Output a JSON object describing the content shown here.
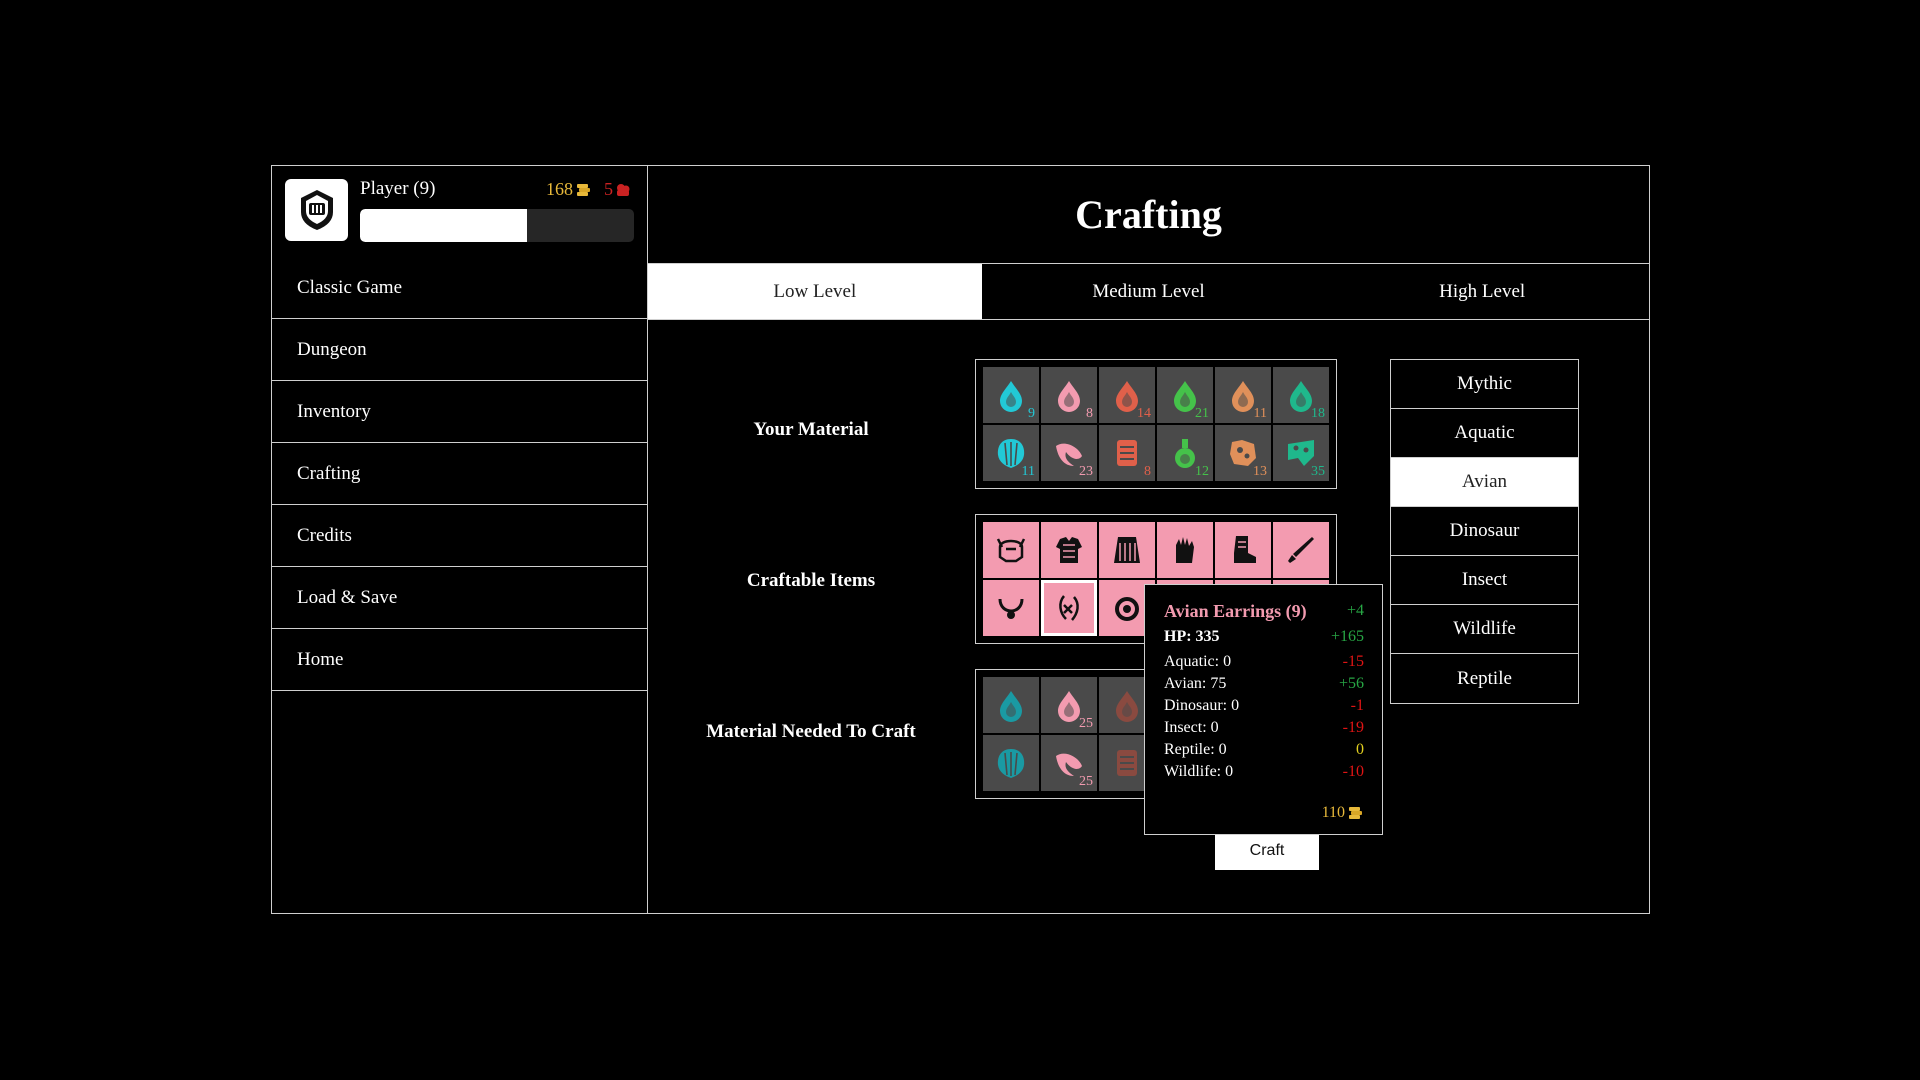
{
  "player": {
    "name": "Player (9)",
    "gold": "168",
    "gems": "5",
    "xp_fraction": 0.61
  },
  "nav": {
    "items": [
      {
        "label": "Classic Game"
      },
      {
        "label": "Dungeon"
      },
      {
        "label": "Inventory"
      },
      {
        "label": "Crafting"
      },
      {
        "label": "Credits"
      },
      {
        "label": "Load & Save"
      },
      {
        "label": "Home"
      }
    ]
  },
  "page": {
    "title": "Crafting"
  },
  "level_tabs": [
    {
      "label": "Low Level",
      "active": true
    },
    {
      "label": "Medium Level",
      "active": false
    },
    {
      "label": "High Level",
      "active": false
    }
  ],
  "sections": {
    "your_material": "Your Material",
    "craftable_items": "Craftable Items",
    "material_needed": "Material Needed To Craft"
  },
  "your_material": [
    {
      "icon": "drop-icon",
      "color": "#22c9d6",
      "count": "9"
    },
    {
      "icon": "drop-icon",
      "color": "#f39bb0",
      "count": "8"
    },
    {
      "icon": "drop-icon",
      "color": "#e0604a",
      "count": "14"
    },
    {
      "icon": "drop-icon",
      "color": "#45c24a",
      "count": "21"
    },
    {
      "icon": "drop-icon",
      "color": "#e0905a",
      "count": "11"
    },
    {
      "icon": "drop-icon",
      "color": "#1fb88c",
      "count": "18"
    },
    {
      "icon": "shell-icon",
      "color": "#22c9d6",
      "count": "11"
    },
    {
      "icon": "feather-icon",
      "color": "#f39bb0",
      "count": "23"
    },
    {
      "icon": "scale-icon",
      "color": "#e0604a",
      "count": "8"
    },
    {
      "icon": "flask-icon",
      "color": "#45c24a",
      "count": "12"
    },
    {
      "icon": "hide-icon",
      "color": "#e0905a",
      "count": "13"
    },
    {
      "icon": "fang-icon",
      "color": "#1fb88c",
      "count": "35"
    }
  ],
  "craftable_items": [
    {
      "icon": "helmet-icon"
    },
    {
      "icon": "armor-icon"
    },
    {
      "icon": "skirt-icon"
    },
    {
      "icon": "gloves-icon"
    },
    {
      "icon": "boots-icon"
    },
    {
      "icon": "weapon-icon"
    },
    {
      "icon": "necklace-icon"
    },
    {
      "icon": "earrings-icon",
      "selected": true
    },
    {
      "icon": "ring-icon"
    },
    {
      "icon": "bracelet-icon"
    },
    {
      "icon": "belt-icon"
    },
    {
      "icon": "amulet-icon"
    }
  ],
  "material_needed": [
    {
      "icon": "drop-icon",
      "color": "#1a9aa3",
      "count": ""
    },
    {
      "icon": "drop-icon",
      "color": "#f39bb0",
      "count": "25"
    },
    {
      "icon": "drop-icon",
      "color": "#8a4a40",
      "count": ""
    },
    {
      "icon": "drop-icon",
      "color": "#555555",
      "count": ""
    },
    {
      "icon": "drop-icon",
      "color": "#555555",
      "count": ""
    },
    {
      "icon": "drop-icon",
      "color": "#555555",
      "count": ""
    },
    {
      "icon": "shell-icon",
      "color": "#1a9aa3",
      "count": ""
    },
    {
      "icon": "feather-icon",
      "color": "#f39bb0",
      "count": "25"
    },
    {
      "icon": "scale-icon",
      "color": "#8a4a40",
      "count": ""
    },
    {
      "icon": "flask-icon",
      "color": "#555555",
      "count": ""
    },
    {
      "icon": "hide-icon",
      "color": "#555555",
      "count": ""
    },
    {
      "icon": "fang-icon",
      "color": "#555555",
      "count": ""
    }
  ],
  "categories": [
    {
      "label": "Mythic",
      "active": false
    },
    {
      "label": "Aquatic",
      "active": false
    },
    {
      "label": "Avian",
      "active": true
    },
    {
      "label": "Dinosaur",
      "active": false
    },
    {
      "label": "Insect",
      "active": false
    },
    {
      "label": "Wildlife",
      "active": false
    },
    {
      "label": "Reptile",
      "active": false
    }
  ],
  "tooltip": {
    "name": "Avian Earrings (9)",
    "level_delta": "+4",
    "hp_label": "HP: 335",
    "hp_delta": "+165",
    "stats": [
      {
        "label": "Aquatic: 0",
        "delta": "-15",
        "kind": "neg"
      },
      {
        "label": "Avian: 75",
        "delta": "+56",
        "kind": "pos"
      },
      {
        "label": "Dinosaur: 0",
        "delta": "-1",
        "kind": "neg"
      },
      {
        "label": "Insect: 0",
        "delta": "-19",
        "kind": "neg"
      },
      {
        "label": "Reptile: 0",
        "delta": "0",
        "kind": "zero"
      },
      {
        "label": "Wildlife: 0",
        "delta": "-10",
        "kind": "neg"
      }
    ],
    "price": "110"
  },
  "craft_button": {
    "label": "Craft"
  },
  "colors": {
    "gold": "#e8b93a",
    "gem": "#c92222",
    "craftable_bg": "#f39bb0",
    "positive": "#27a644",
    "negative": "#e01414",
    "neutral": "#e3d01f"
  }
}
